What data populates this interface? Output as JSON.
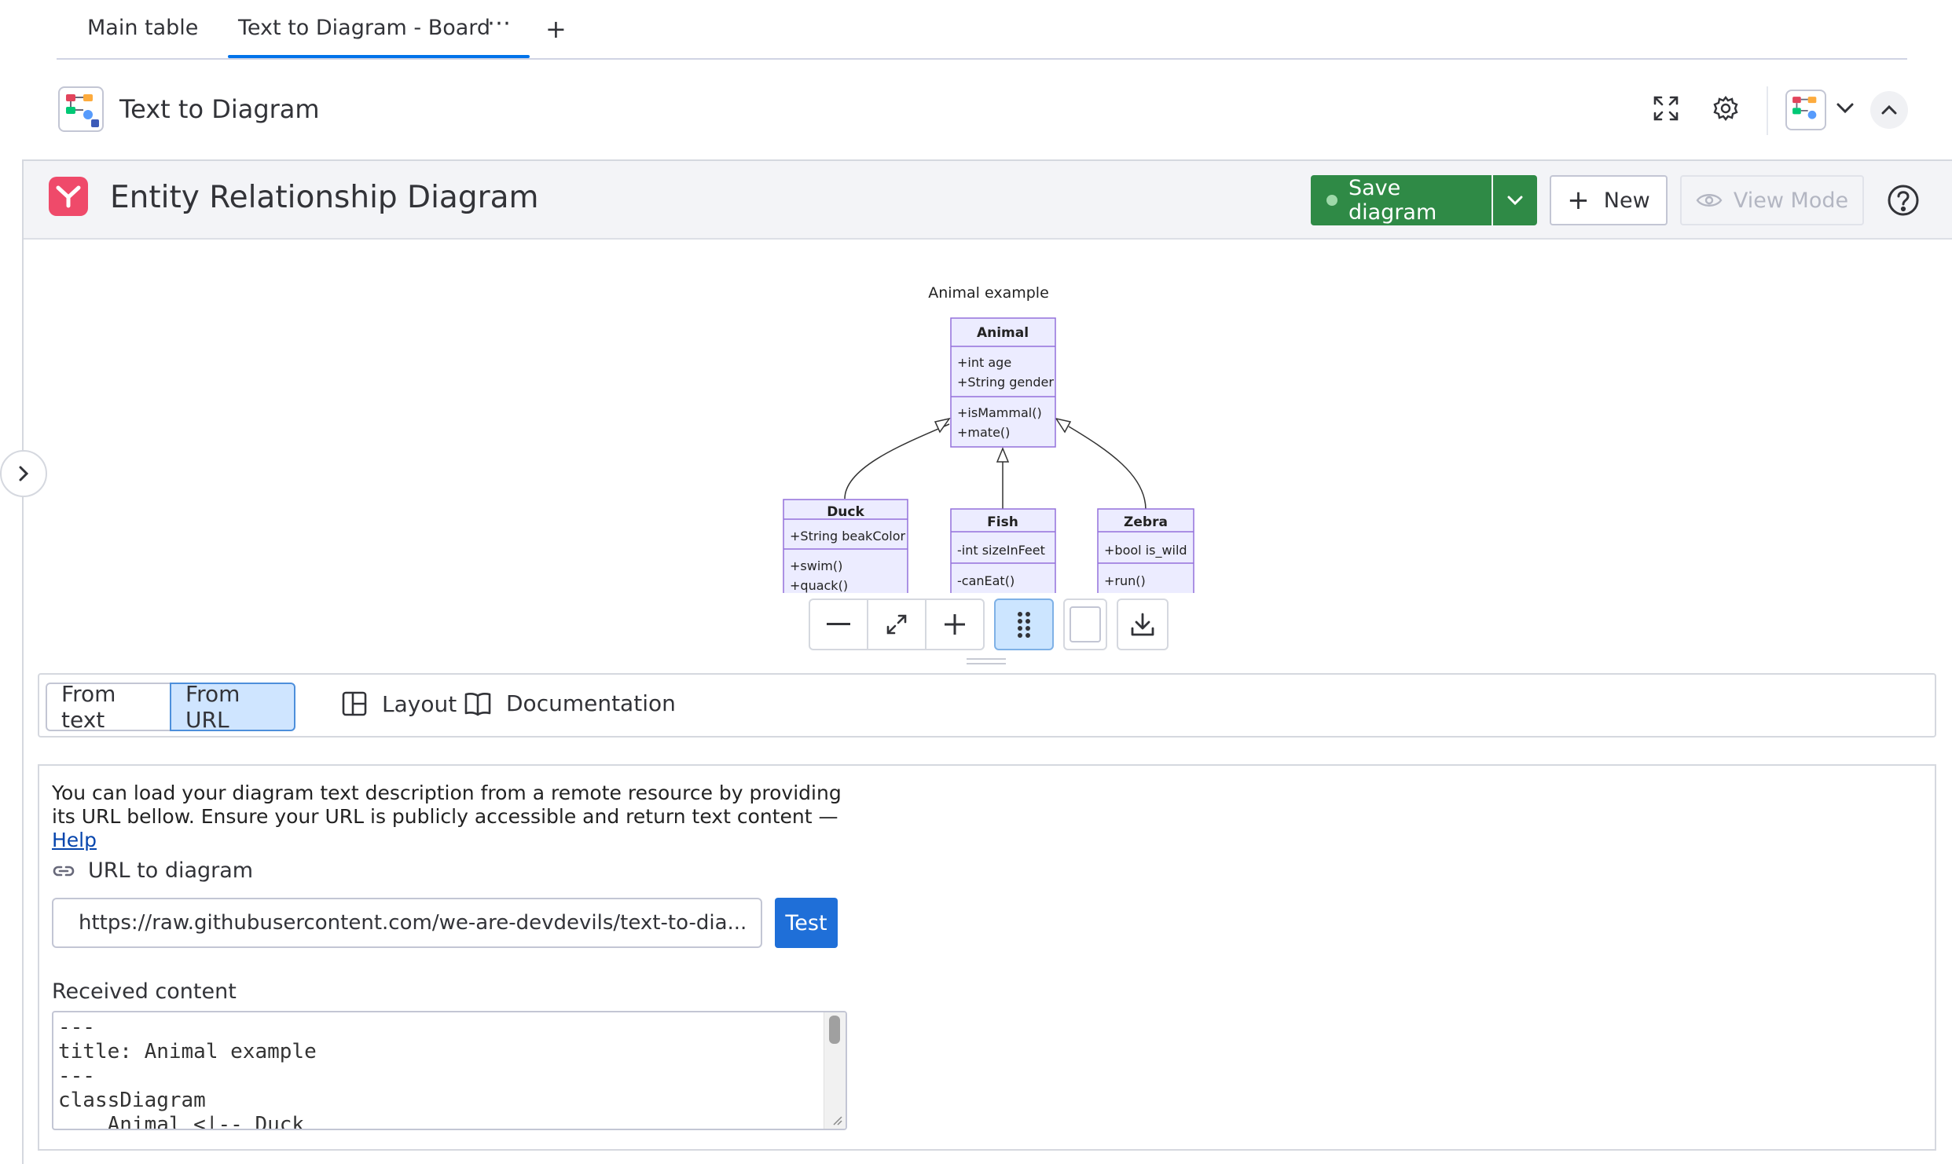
{
  "board_tabs": {
    "items": [
      {
        "label": "Main table"
      },
      {
        "label": "Text to Diagram - Board"
      }
    ],
    "more_icon": "three-dots-icon",
    "add_icon": "plus-icon"
  },
  "view": {
    "title": "Text to Diagram",
    "icons": [
      "fullscreen-icon",
      "gear-icon",
      "chevron-down-icon",
      "chevron-up-icon"
    ]
  },
  "app": {
    "title": "Entity Relationship Diagram",
    "save_label": "Save diagram",
    "new_label": "New",
    "view_mode_label": "View Mode",
    "accent": "#2f8a46",
    "brand_color": "#ef4a6a"
  },
  "diagram": {
    "title": "Animal example",
    "classes": [
      {
        "name": "Animal",
        "attributes": [
          "+int age",
          "+String gender"
        ],
        "methods": [
          "+isMammal()",
          "+mate()"
        ]
      },
      {
        "name": "Duck",
        "attributes": [
          "+String beakColor"
        ],
        "methods": [
          "+swim()",
          "+quack()"
        ]
      },
      {
        "name": "Fish",
        "attributes": [
          "-int sizeInFeet"
        ],
        "methods": [
          "-canEat()"
        ]
      },
      {
        "name": "Zebra",
        "attributes": [
          "+bool is_wild"
        ],
        "methods": [
          "+run()"
        ]
      }
    ],
    "class_fill": "#ececff",
    "class_stroke": "#9370db"
  },
  "zoom_controls": [
    "zoom-out-icon",
    "fit-icon",
    "zoom-in-icon",
    "drag-handle-icon",
    "background-swatch",
    "download-icon"
  ],
  "modes": {
    "from_text": "From text",
    "from_url": "From URL",
    "layout": "Layout",
    "documentation": "Documentation"
  },
  "url_panel": {
    "description": "You can load your diagram text description from a remote resource by providing its URL bellow. Ensure your URL is publicly accessible and return text content —",
    "help_link": "Help",
    "url_label": "URL to diagram",
    "url_value": "https://raw.githubusercontent.com/we-are-devdevils/text-to-dia...",
    "test_label": "Test",
    "received_label": "Received content",
    "received_lines": [
      "---",
      "title: Animal example",
      "---",
      "classDiagram",
      "    Animal <|-- Duck"
    ]
  }
}
